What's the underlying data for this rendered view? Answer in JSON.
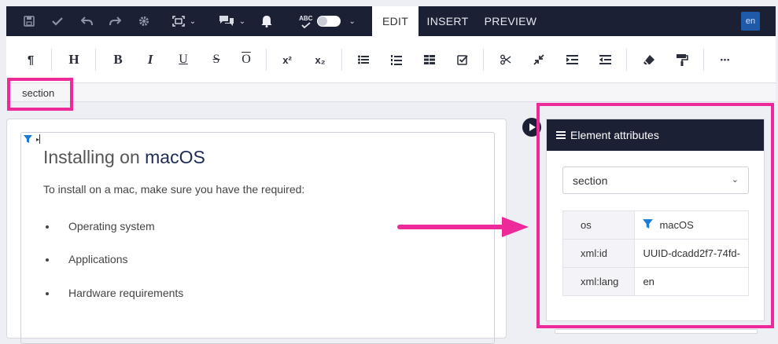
{
  "topbar": {
    "tabs": [
      {
        "label": "EDIT",
        "active": true
      },
      {
        "label": "INSERT",
        "active": false
      },
      {
        "label": "PREVIEW",
        "active": false
      }
    ],
    "spellcheck_label": "ABC",
    "language_badge": "en",
    "icons": [
      "save-icon",
      "check-icon",
      "undo-icon",
      "redo-icon",
      "gear-icon",
      "fullscreen-icon",
      "comments-icon",
      "bell-icon",
      "spellcheck-icon"
    ]
  },
  "toolbar": {
    "paragraph": "¶",
    "heading": "H",
    "bold": "B",
    "italic": "I",
    "underline": "U",
    "strike": "S",
    "overline": "O",
    "superscript": "x²",
    "subscript": "x₂",
    "more": "•••"
  },
  "breadcrumb": {
    "label": "section"
  },
  "document": {
    "title_prefix": "Installing on",
    "title_os": "macOS",
    "intro": "To install on a mac, make sure you have the required:",
    "items": [
      "Operating system",
      "Applications",
      "Hardware requirements"
    ]
  },
  "attributes_panel": {
    "title": "Element attributes",
    "element_select": "section",
    "rows": [
      {
        "key": "os",
        "value": "macOS",
        "has_filter_icon": true
      },
      {
        "key": "xml:id",
        "value": "UUID-dcadd2f7-74fd-"
      },
      {
        "key": "xml:lang",
        "value": "en"
      }
    ]
  },
  "colors": {
    "topbar_bg": "#1c2034",
    "highlight": "#ee2a9a",
    "filter_icon": "#1d7bd8",
    "language_badge": "#1f5aa8"
  }
}
